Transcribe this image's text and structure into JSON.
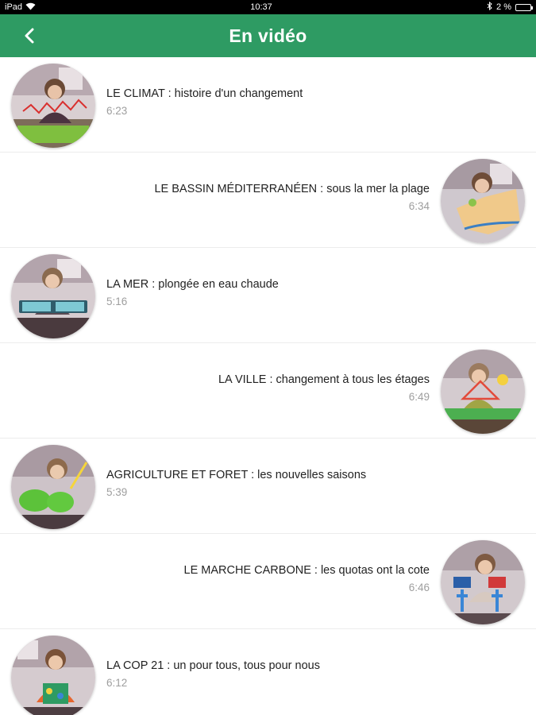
{
  "status_bar": {
    "device": "iPad",
    "time": "10:37",
    "battery_text": "2 %",
    "battery_level": 0.02
  },
  "header": {
    "title": "En vidéo",
    "back_icon": "chevron-left-icon",
    "color": "#2e9b63"
  },
  "videos": [
    {
      "title": "LE CLIMAT : histoire d'un changement",
      "duration": "6:23",
      "align": "left"
    },
    {
      "title": "LE BASSIN MÉDITERRANÉEN : sous la mer la plage",
      "duration": "6:34",
      "align": "right"
    },
    {
      "title": "LA MER : plongée en eau chaude",
      "duration": "5:16",
      "align": "left"
    },
    {
      "title": "LA VILLE : changement à tous les étages",
      "duration": "6:49",
      "align": "right"
    },
    {
      "title": "AGRICULTURE ET FORET : les nouvelles saisons",
      "duration": "5:39",
      "align": "left"
    },
    {
      "title": "LE MARCHE CARBONE : les quotas ont la cote",
      "duration": "6:46",
      "align": "right"
    },
    {
      "title": "LA COP 21 : un pour tous, tous pour nous",
      "duration": "6:12",
      "align": "left"
    }
  ]
}
